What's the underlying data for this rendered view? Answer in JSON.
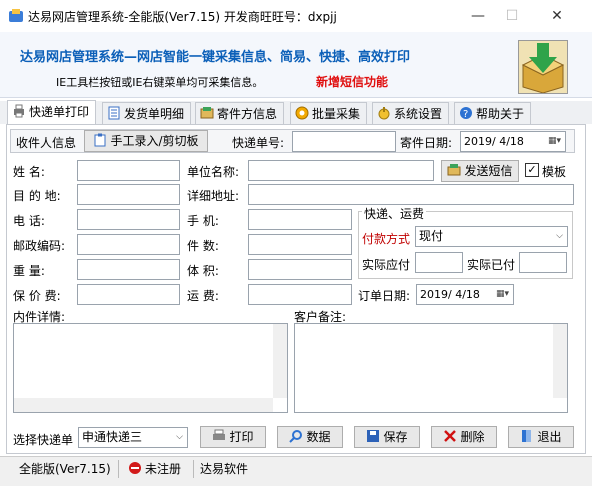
{
  "window": {
    "title": "达易网店管理系统-全能版(Ver7.15) 开发商旺旺号：dxpjj",
    "minimize": "—",
    "maximize": "☐",
    "close": "✕"
  },
  "banner": {
    "title": "达易网店管理系统—网店智能一键采集信息、简易、快捷、高效打印",
    "subtitle": "IE工具栏按钮或IE右键菜单均可采集信息。",
    "new_feature": "新增短信功能"
  },
  "tabs": [
    {
      "label": "快递单打印"
    },
    {
      "label": "发货单明细"
    },
    {
      "label": "寄件方信息"
    },
    {
      "label": "批量采集"
    },
    {
      "label": "系统设置"
    },
    {
      "label": "帮助关于"
    }
  ],
  "subbar": {
    "recipient_label": "收件人信息",
    "manual_button": "手工录入/剪切板",
    "tracking_label": "快递单号:",
    "tracking_value": "",
    "send_date_label": "寄件日期:",
    "send_date_value": "2019/ 4/18"
  },
  "form": {
    "name_label": "姓    名:",
    "company_label": "单位名称:",
    "send_sms_button": "发送短信",
    "template_label": "模板",
    "template_checked": true,
    "destination_label": "目 的 地:",
    "address_label": "详细地址:",
    "phone_label": "电    话:",
    "mobile_label": "手    机:",
    "postcode_label": "邮政编码:",
    "pieces_label": "件    数:",
    "weight_label": "重    量:",
    "volume_label": "体    积:",
    "insured_label": "保 价 费:",
    "freight_label": "运    费:",
    "order_date_label": "订单日期:",
    "order_date_value": "2019/ 4/18",
    "items_label": "内件详情:",
    "notes_label": "客户备注:"
  },
  "shipping_group": {
    "title": "快递、运费",
    "payment_label": "付款方式",
    "payment_value": "现付",
    "payable_label": "实际应付",
    "paid_label": "实际已付"
  },
  "bottom": {
    "select_label": "选择快递单",
    "select_value": "申通快递三",
    "print_button": "打印",
    "data_button": "数据",
    "save_button": "保存",
    "delete_button": "删除",
    "exit_button": "退出"
  },
  "status": {
    "edition": "全能版(Ver7.15)",
    "registration": "未注册",
    "company": "达易软件"
  }
}
